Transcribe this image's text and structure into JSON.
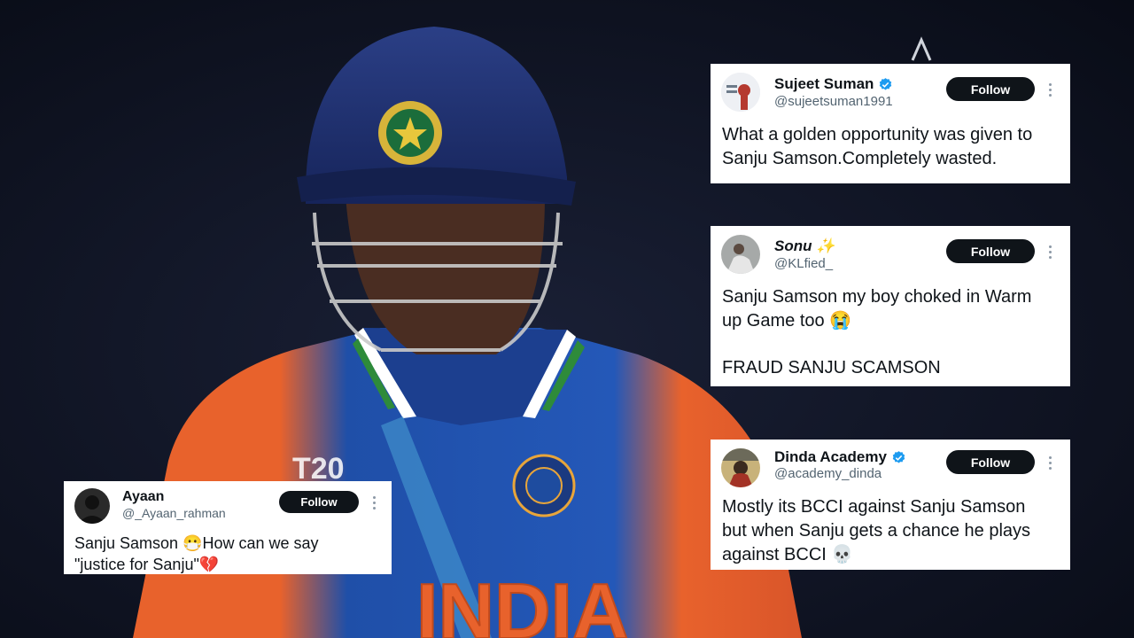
{
  "tweets": [
    {
      "name": "Sujeet Suman",
      "verified": true,
      "handle": "@sujeetsuman1991",
      "follow_label": "Follow",
      "text": "What a golden opportunity was given to\nSanju Samson.Completely wasted."
    },
    {
      "name": "Sonu ✨",
      "verified": false,
      "handle": "@KLfied_",
      "follow_label": "Follow",
      "text": "Sanju Samson my boy choked in Warm\nup Game too 😭\n\nFRAUD SANJU SCAMSON"
    },
    {
      "name": "Dinda Academy",
      "verified": true,
      "handle": "@academy_dinda",
      "follow_label": "Follow",
      "text": "Mostly its BCCI against Sanju Samson\nbut when Sanju gets a chance he plays\nagainst BCCI 💀"
    },
    {
      "name": "Ayaan",
      "verified": false,
      "handle": "@_Ayaan_rahman",
      "follow_label": "Follow",
      "text": "Sanju Samson 😷How can we say\n\"justice for Sanju\"💔"
    }
  ],
  "photo": {
    "jersey_text": "INDIA",
    "colors": {
      "helmet": "#1d2f6f",
      "jersey_blue": "#1f4fa8",
      "jersey_orange": "#e8622c",
      "background": "#0d1120",
      "verified_blue": "#1d9bf0",
      "follow_button": "#0f1419"
    }
  }
}
